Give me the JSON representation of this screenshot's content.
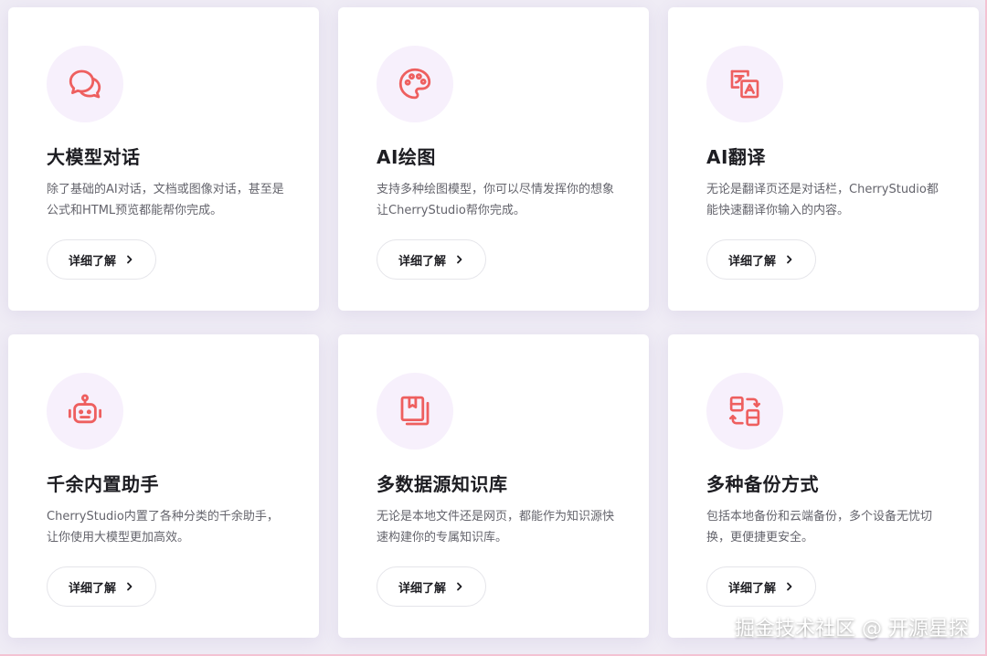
{
  "colors": {
    "page_bg": "#efecf5",
    "card_bg": "#ffffff",
    "icon_bg": "#f7f0fc",
    "accent": "#ee5f5f"
  },
  "cards": [
    {
      "icon": "chat-bubbles-icon",
      "title": "大模型对话",
      "desc": "除了基础的AI对话，文档或图像对话，甚至是公式和HTML预览都能帮你完成。",
      "button": "详细了解"
    },
    {
      "icon": "palette-icon",
      "title": "AI绘图",
      "desc": "支持多种绘图模型，你可以尽情发挥你的想象让CherryStudio帮你完成。",
      "button": "详细了解"
    },
    {
      "icon": "translate-icon",
      "title": "AI翻译",
      "desc": "无论是翻译页还是对话栏，CherryStudio都能快速翻译你输入的内容。",
      "button": "详细了解"
    },
    {
      "icon": "robot-icon",
      "title": "千余内置助手",
      "desc": "CherryStudio内置了各种分类的千余助手，让你使用大模型更加高效。",
      "button": "详细了解"
    },
    {
      "icon": "knowledge-base-icon",
      "title": "多数据源知识库",
      "desc": "无论是本地文件还是网页，都能作为知识源快速构建你的专属知识库。",
      "button": "详细了解"
    },
    {
      "icon": "backup-sync-icon",
      "title": "多种备份方式",
      "desc": "包括本地备份和云端备份，多个设备无忧切换，更便捷更安全。",
      "button": "详细了解"
    }
  ],
  "watermark": "掘金技术社区 @ 开源星探"
}
